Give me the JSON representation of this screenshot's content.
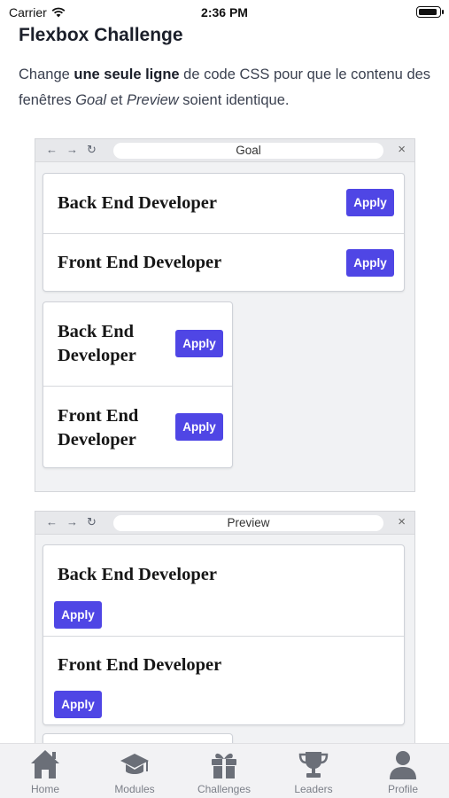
{
  "status_bar": {
    "carrier": "Carrier",
    "time": "2:36 PM"
  },
  "page": {
    "title": "Flexbox Challenge",
    "intro": {
      "t1": "Change ",
      "b1": "une seule ligne",
      "t2": " de code CSS pour que le contenu des fenêtres ",
      "i1": "Goal",
      "t3": " et ",
      "i2": "Preview",
      "t4": " soient identique."
    }
  },
  "goal_window": {
    "url": "Goal",
    "close": "×",
    "wide_box": [
      {
        "title": "Back End Developer",
        "button": "Apply"
      },
      {
        "title": "Front End Developer",
        "button": "Apply"
      }
    ],
    "narrow_box": [
      {
        "title_line1": "Back End",
        "title_line2": "Developer",
        "button": "Apply"
      },
      {
        "title_line1": "Front End",
        "title_line2": "Developer",
        "button": "Apply"
      }
    ]
  },
  "preview_window": {
    "url": "Preview",
    "close": "×",
    "wide_box": [
      {
        "title": "Back End Developer",
        "button": "Apply"
      },
      {
        "title": "Front End Developer",
        "button": "Apply"
      }
    ]
  },
  "tab_bar": {
    "tabs": [
      {
        "label": "Home",
        "icon": "home-icon"
      },
      {
        "label": "Modules",
        "icon": "graduation-cap-icon"
      },
      {
        "label": "Challenges",
        "icon": "gift-icon"
      },
      {
        "label": "Leaders",
        "icon": "trophy-icon"
      },
      {
        "label": "Profile",
        "icon": "person-icon"
      }
    ]
  },
  "colors": {
    "accent": "#4f46e5",
    "tab_icon": "#6b6f78"
  }
}
